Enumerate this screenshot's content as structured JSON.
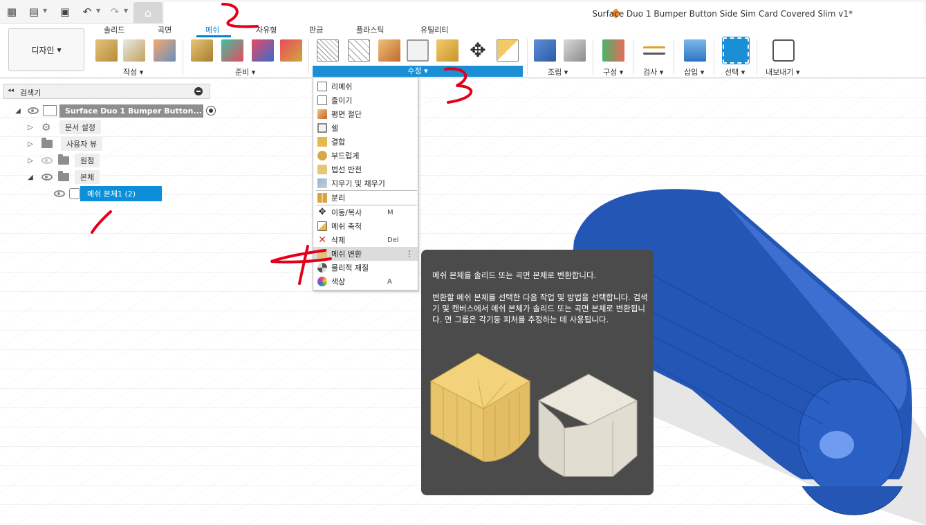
{
  "app": {
    "document_title": "Surface Duo 1 Bumper Button Side Sim Card Covered Slim v1*"
  },
  "ribbon": {
    "workspace_label": "디자인",
    "tabs": [
      {
        "label": "솔리드",
        "active": false
      },
      {
        "label": "곡면",
        "active": false
      },
      {
        "label": "메쉬",
        "active": true
      },
      {
        "label": "자유형",
        "active": false
      },
      {
        "label": "판금",
        "active": false
      },
      {
        "label": "플라스틱",
        "active": false
      },
      {
        "label": "유틸리티",
        "active": false
      }
    ],
    "groups": {
      "create": "작성",
      "prepare": "준비",
      "modify": "수정",
      "assemble": "조립",
      "construct": "구성",
      "inspect": "검사",
      "insert": "삽입",
      "select": "선택",
      "export": "내보내기"
    }
  },
  "browser": {
    "title": "검색기",
    "root": "Surface Duo 1 Bumper Button...",
    "items": [
      {
        "label": "문서 설정"
      },
      {
        "label": "사용자 뷰"
      },
      {
        "label": "원점"
      },
      {
        "label": "본체"
      }
    ],
    "selected_body": "메쉬 본체1 (2)"
  },
  "menu": {
    "items": [
      {
        "label": "리메쉬",
        "shortcut": ""
      },
      {
        "label": "줄이기",
        "shortcut": ""
      },
      {
        "label": "평면 절단",
        "shortcut": ""
      },
      {
        "label": "쉘",
        "shortcut": ""
      },
      {
        "label": "결합",
        "shortcut": ""
      },
      {
        "label": "부드럽게",
        "shortcut": ""
      },
      {
        "label": "법선 반전",
        "shortcut": ""
      },
      {
        "label": "지우기 및 채우기",
        "shortcut": ""
      },
      {
        "label": "분리",
        "shortcut": ""
      },
      {
        "label": "이동/복사",
        "shortcut": "M"
      },
      {
        "label": "메쉬 축척",
        "shortcut": ""
      },
      {
        "label": "삭제",
        "shortcut": "Del"
      },
      {
        "label": "메쉬 변환",
        "shortcut": ""
      },
      {
        "label": "물리적 재질",
        "shortcut": ""
      },
      {
        "label": "색상",
        "shortcut": "A"
      }
    ],
    "highlighted": "메쉬 변환"
  },
  "tooltip": {
    "line1": "메쉬 본체를 솔리드 또는 곡면 본체로 변환합니다.",
    "line2": "변환할 메쉬 본체를 선택한 다음 작업 및 방법을 선택합니다. 검색기 및 캔버스에서 메쉬 본체가 솔리드 또는 곡면 본체로 변환됩니다. 면 그룹은 각기둥 피처를 추정하는 데 사용됩니다."
  },
  "annotations": [
    "1",
    "2",
    "3",
    "4"
  ],
  "colors": {
    "accent": "#0b7fc9",
    "modify_bar": "#1a8fd6",
    "mesh_body": "#2456b5",
    "annotation": "#e3001b",
    "tooltip_bg": "#4b4b4b"
  }
}
